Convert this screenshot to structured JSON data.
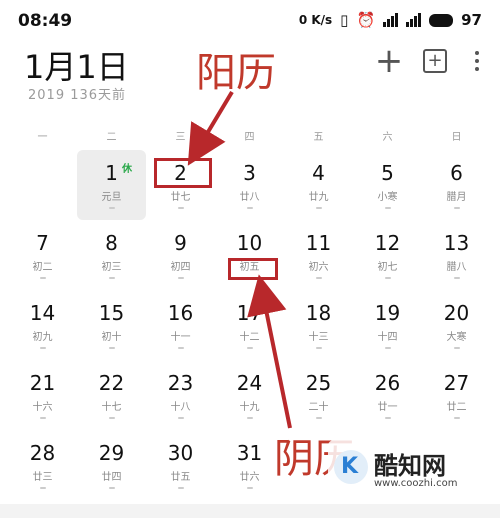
{
  "status_bar": {
    "time": "08:49",
    "network_speed": "0 K/s",
    "battery_level": "97"
  },
  "header": {
    "title": "1月1日",
    "year": "2019",
    "relative": "136天前",
    "add_icon": "plus-icon",
    "add_box_icon": "add-box-icon",
    "more_icon": "more-vert-icon"
  },
  "weekdays": [
    "一",
    "二",
    "三",
    "四",
    "五",
    "六",
    "日"
  ],
  "weeks": [
    [
      {
        "day": "1",
        "lunar": "元旦",
        "badge": "休",
        "today": true
      },
      {
        "day": "2",
        "lunar": "廿七"
      },
      {
        "day": "3",
        "lunar": "廿八"
      },
      {
        "day": "4",
        "lunar": "廿九"
      },
      {
        "day": "5",
        "lunar": "小寒"
      },
      {
        "day": "6",
        "lunar": "腊月"
      }
    ],
    [
      {
        "day": "7",
        "lunar": "初二"
      },
      {
        "day": "8",
        "lunar": "初三"
      },
      {
        "day": "9",
        "lunar": "初四"
      },
      {
        "day": "10",
        "lunar": "初五"
      },
      {
        "day": "11",
        "lunar": "初六"
      },
      {
        "day": "12",
        "lunar": "初七"
      },
      {
        "day": "13",
        "lunar": "腊八"
      }
    ],
    [
      {
        "day": "14",
        "lunar": "初九"
      },
      {
        "day": "15",
        "lunar": "初十"
      },
      {
        "day": "16",
        "lunar": "十一"
      },
      {
        "day": "17",
        "lunar": "十二"
      },
      {
        "day": "18",
        "lunar": "十三"
      },
      {
        "day": "19",
        "lunar": "十四"
      },
      {
        "day": "20",
        "lunar": "大寒"
      }
    ],
    [
      {
        "day": "21",
        "lunar": "十六"
      },
      {
        "day": "22",
        "lunar": "十七"
      },
      {
        "day": "23",
        "lunar": "十八"
      },
      {
        "day": "24",
        "lunar": "十九"
      },
      {
        "day": "25",
        "lunar": "二十"
      },
      {
        "day": "26",
        "lunar": "廿一"
      },
      {
        "day": "27",
        "lunar": "廿二"
      }
    ],
    [
      {
        "day": "28",
        "lunar": "廿三"
      },
      {
        "day": "29",
        "lunar": "廿四"
      },
      {
        "day": "30",
        "lunar": "廿五"
      },
      {
        "day": "31",
        "lunar": "廿六"
      }
    ]
  ],
  "annotations": {
    "solar_label": "阳历",
    "lunar_label": "阴历",
    "color": "#b8282b"
  },
  "watermark": {
    "name": "酷知网",
    "url": "www.coozhi.com"
  }
}
